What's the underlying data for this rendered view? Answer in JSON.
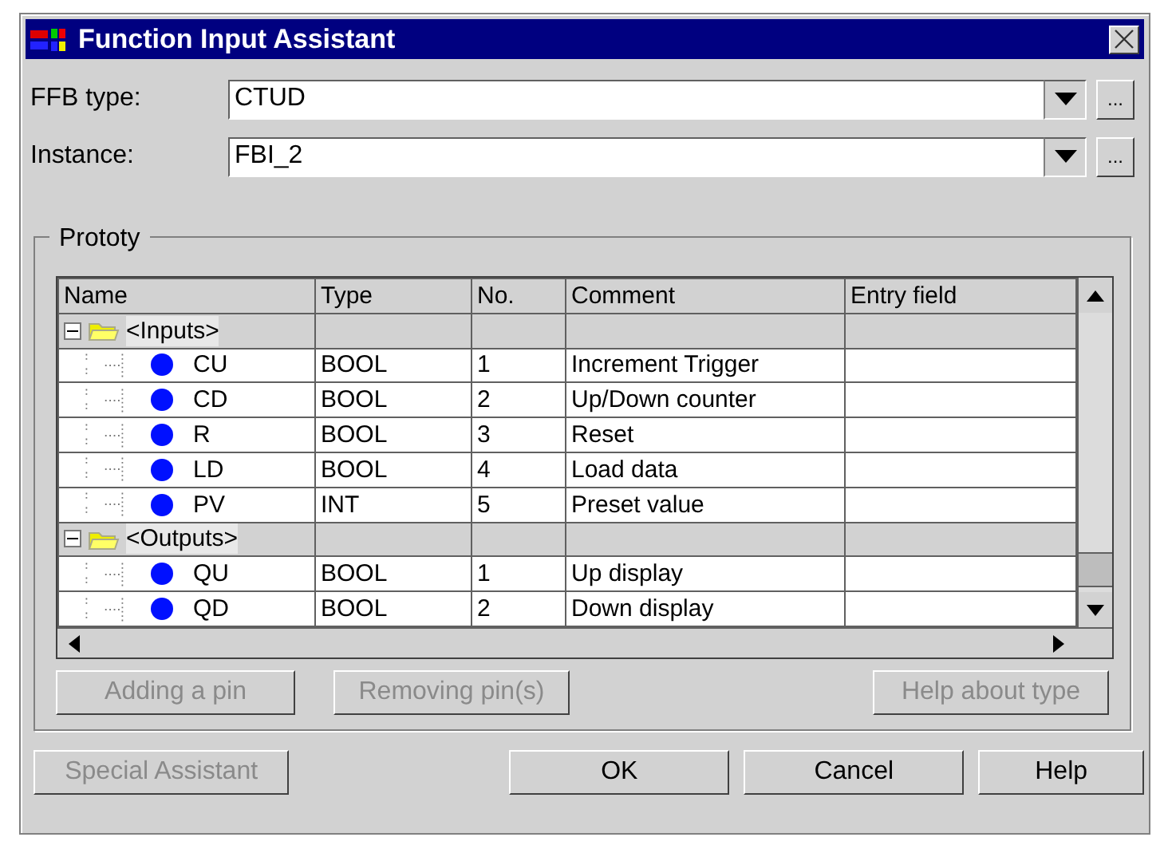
{
  "window": {
    "title": "Function Input Assistant"
  },
  "fields": [
    {
      "label": "FFB type:",
      "value": "CTUD",
      "browse": "..."
    },
    {
      "label": "Instance:",
      "value": "FBI_2",
      "browse": "..."
    }
  ],
  "prototype": {
    "legend": "Prototy",
    "table": {
      "columns": [
        "Name",
        "Type",
        "No.",
        "Comment",
        "Entry field"
      ],
      "groups": [
        {
          "name": "<Inputs>",
          "expanded": true,
          "children": [
            {
              "name": "CU",
              "type": "BOOL",
              "no": "1",
              "comment": "Increment Trigger"
            },
            {
              "name": "CD",
              "type": "BOOL",
              "no": "2",
              "comment": "Up/Down counter"
            },
            {
              "name": "R",
              "type": "BOOL",
              "no": "3",
              "comment": "Reset"
            },
            {
              "name": "LD",
              "type": "BOOL",
              "no": "4",
              "comment": "Load data"
            },
            {
              "name": "PV",
              "type": "INT",
              "no": "5",
              "comment": "Preset value"
            }
          ]
        },
        {
          "name": "<Outputs>",
          "expanded": true,
          "children": [
            {
              "name": "QU",
              "type": "BOOL",
              "no": "1",
              "comment": "Up display"
            },
            {
              "name": "QD",
              "type": "BOOL",
              "no": "2",
              "comment": "Down display"
            }
          ]
        }
      ]
    },
    "buttons": [
      {
        "label": "Adding a pin",
        "disabled": true
      },
      {
        "label": "Removing pin(s)",
        "disabled": true
      },
      {
        "label": "Help about type",
        "disabled": true
      }
    ]
  },
  "footer_buttons": [
    {
      "label": "Special Assistant",
      "disabled": true
    },
    {
      "label": "OK",
      "disabled": false
    },
    {
      "label": "Cancel",
      "disabled": false
    },
    {
      "label": "Help",
      "disabled": false
    }
  ]
}
